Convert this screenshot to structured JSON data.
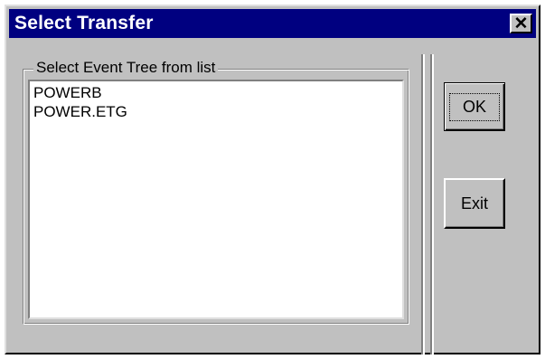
{
  "window": {
    "title": "Select Transfer",
    "close_glyph": "✕",
    "close_icon": "close-icon",
    "title_color": "#000080",
    "face_color": "#c0c0c0"
  },
  "group": {
    "label": "Select Event Tree from list"
  },
  "list": {
    "items": [
      "POWERB",
      "POWER.ETG"
    ]
  },
  "buttons": {
    "ok_label": "OK",
    "exit_label": "Exit"
  }
}
